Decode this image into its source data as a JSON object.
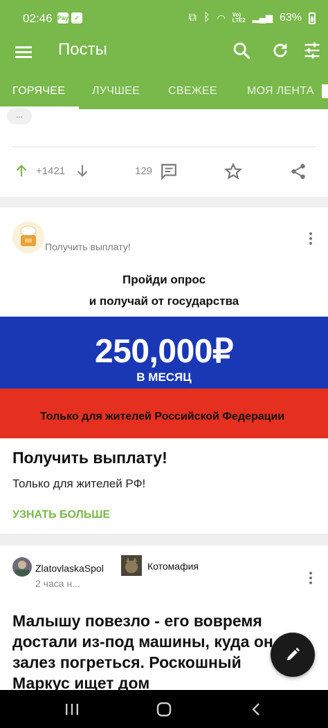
{
  "status_bar": {
    "time": "02:46",
    "battery": "63%",
    "net": "Vo)\nLTE2"
  },
  "app_bar": {
    "title": "Посты"
  },
  "tabs": [
    {
      "label": "ГОРЯЧЕЕ",
      "active": true
    },
    {
      "label": "ЛУЧШЕЕ",
      "active": false
    },
    {
      "label": "СВЕЖЕЕ",
      "active": false
    },
    {
      "label": "МОЯ ЛЕНТА",
      "active": false
    }
  ],
  "prev_post": {
    "more_label": "...",
    "rating": "+1421",
    "comments": "129"
  },
  "ad": {
    "advertiser": "Получить выплату!",
    "banner_line1": "Пройди опрос",
    "banner_line2": "и получай от государства",
    "amount": "250,000₽",
    "period": "В МЕСЯЦ",
    "residents_note": "Только для жителей Российской Федерации",
    "title": "Получить выплату!",
    "description": "Только для жителей РФ!",
    "cta": "УЗНАТЬ БОЛЬШЕ"
  },
  "post": {
    "author": "ZlatovlaskaSpol",
    "community": "Котомафия",
    "time": "2 часа н...",
    "title": "Малышу повезло - его вовремя достали из-под машины, куда он залез погреться. Роскошный Маркус ищет дом"
  },
  "colors": {
    "brand": "#79b84b",
    "flag_blue": "#1a38b5",
    "flag_red": "#e53020"
  }
}
